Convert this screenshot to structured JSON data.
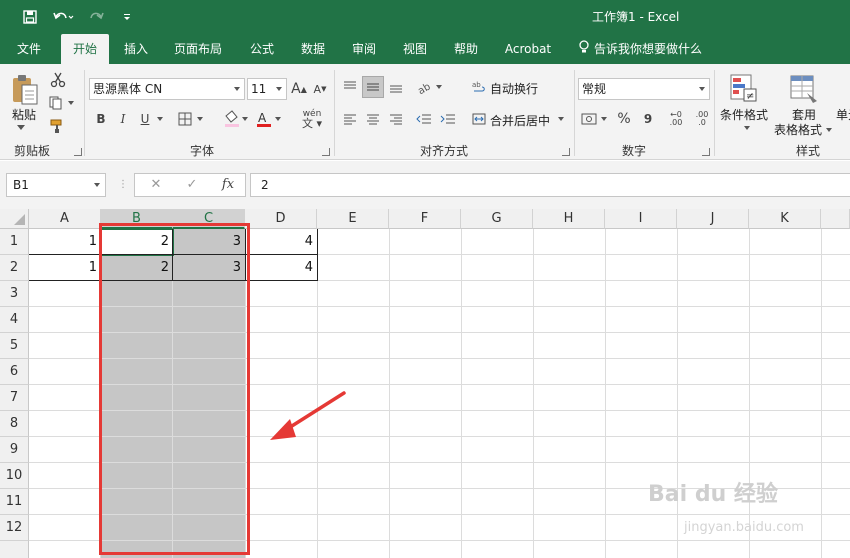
{
  "window": {
    "title": "工作簿1  -  Excel"
  },
  "ribbon": {
    "tabs": [
      "文件",
      "开始",
      "插入",
      "页面布局",
      "公式",
      "数据",
      "审阅",
      "视图",
      "帮助",
      "Acrobat"
    ],
    "active_tab": "开始",
    "tell_me": "告诉我你想要做什么",
    "clipboard": {
      "paste_label": "粘贴",
      "group_label": "剪贴板"
    },
    "font": {
      "name": "思源黑体 CN",
      "size": "11",
      "group_label": "字体",
      "bold": "B",
      "italic": "I",
      "underline": "U",
      "grow": "A",
      "shrink": "A",
      "phonetic": "wén"
    },
    "alignment": {
      "wrap": "自动换行",
      "merge": "合并后居中",
      "group_label": "对齐方式"
    },
    "number": {
      "format": "常规",
      "group_label": "数字",
      "percent": "%",
      "comma": "9",
      "inc": ".00",
      "dec": ".0"
    },
    "styles": {
      "conditional": "条件格式",
      "table_line1": "套用",
      "table_line2": "表格格式",
      "cell_styles": "单元",
      "group_label": "样式"
    }
  },
  "formula_bar": {
    "name_box": "B1",
    "cancel_icon": "✕",
    "enter_icon": "✓",
    "fx": "fx",
    "value": "2"
  },
  "sheet": {
    "columns": [
      "A",
      "B",
      "C",
      "D",
      "E",
      "F",
      "G",
      "H",
      "I",
      "J",
      "K"
    ],
    "selected_columns": [
      "B",
      "C"
    ],
    "rows": [
      "1",
      "2",
      "3",
      "4",
      "5",
      "6",
      "7",
      "8",
      "9",
      "10",
      "11",
      "12"
    ],
    "cells": [
      {
        "ref": "A1",
        "value": "1"
      },
      {
        "ref": "B1",
        "value": "2"
      },
      {
        "ref": "C1",
        "value": "3"
      },
      {
        "ref": "D1",
        "value": "4"
      },
      {
        "ref": "A2",
        "value": "1"
      },
      {
        "ref": "B2",
        "value": "2"
      },
      {
        "ref": "C2",
        "value": "3"
      },
      {
        "ref": "D2",
        "value": "4"
      }
    ],
    "active_cell": "B1"
  },
  "annotation": {
    "color": "#e53935"
  },
  "watermark": {
    "text": "Bai du 经验",
    "sub": "jingyan.baidu.com"
  },
  "colors": {
    "excel_green": "#217346",
    "selection_gray": "#c6c6c6"
  }
}
